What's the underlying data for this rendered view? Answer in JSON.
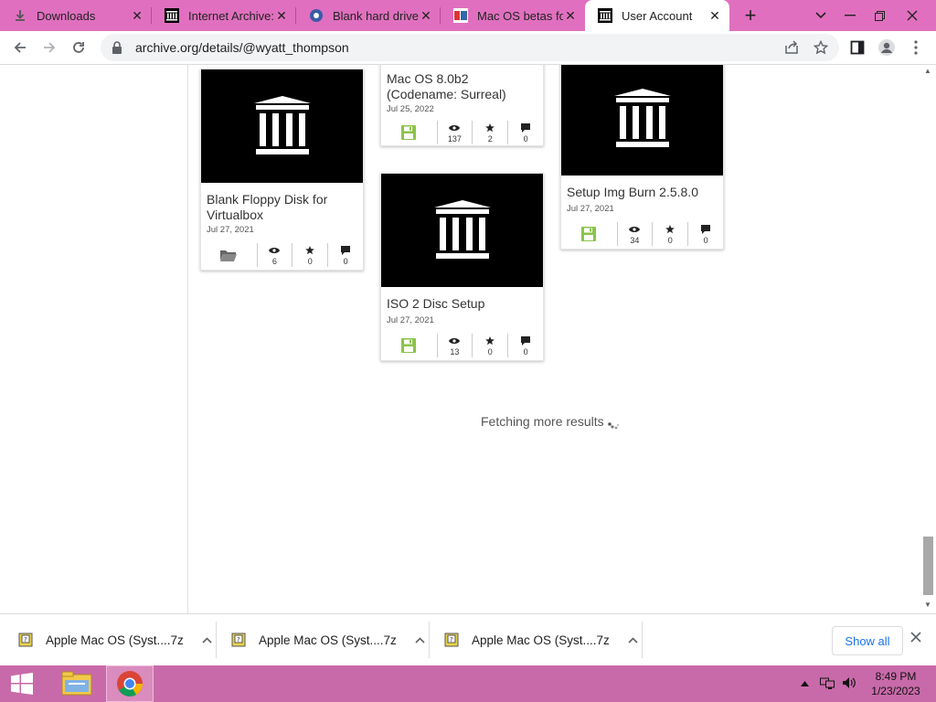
{
  "browser": {
    "tabs": [
      {
        "title": "Downloads",
        "favicon": "download-icon",
        "active": false
      },
      {
        "title": "Internet Archive:",
        "favicon": "archive-icon",
        "active": false
      },
      {
        "title": "Blank hard drive (",
        "favicon": "site-icon",
        "active": false
      },
      {
        "title": "Mac OS betas for",
        "favicon": "site-icon",
        "active": false
      },
      {
        "title": "User Account",
        "favicon": "archive-icon",
        "active": true
      }
    ],
    "url": "archive.org/details/@wyatt_thompson"
  },
  "items": [
    {
      "title": "Blank Floppy Disk for Virtualbox",
      "date": "Jul 27, 2021",
      "type_icon": "folder-icon",
      "views": "6",
      "favorites": "0",
      "reviews": "0"
    },
    {
      "title": "Mac OS 8.0b2 (Codename: Surreal)",
      "date": "Jul 25, 2022",
      "type_icon": "floppy-icon",
      "views": "137",
      "favorites": "2",
      "reviews": "0"
    },
    {
      "title": "ISO 2 Disc Setup",
      "date": "Jul 27, 2021",
      "type_icon": "floppy-icon",
      "views": "13",
      "favorites": "0",
      "reviews": "0"
    },
    {
      "title": "Setup Img Burn 2.5.8.0",
      "date": "Jul 27, 2021",
      "type_icon": "floppy-icon",
      "views": "34",
      "favorites": "0",
      "reviews": "0"
    }
  ],
  "status": {
    "fetching": "Fetching more results"
  },
  "downloads": {
    "items": [
      {
        "name": "Apple Mac OS (Syst....7z"
      },
      {
        "name": "Apple Mac OS (Syst....7z"
      },
      {
        "name": "Apple Mac OS (Syst....7z"
      }
    ],
    "show_all": "Show all"
  },
  "taskbar": {
    "time": "8:49 PM",
    "date": "1/23/2023"
  },
  "colors": {
    "tabstrip": "#e070bf",
    "taskbar": "#c86aa9",
    "floppy_green": "#8bc34a",
    "link_blue": "#1a73e8"
  }
}
